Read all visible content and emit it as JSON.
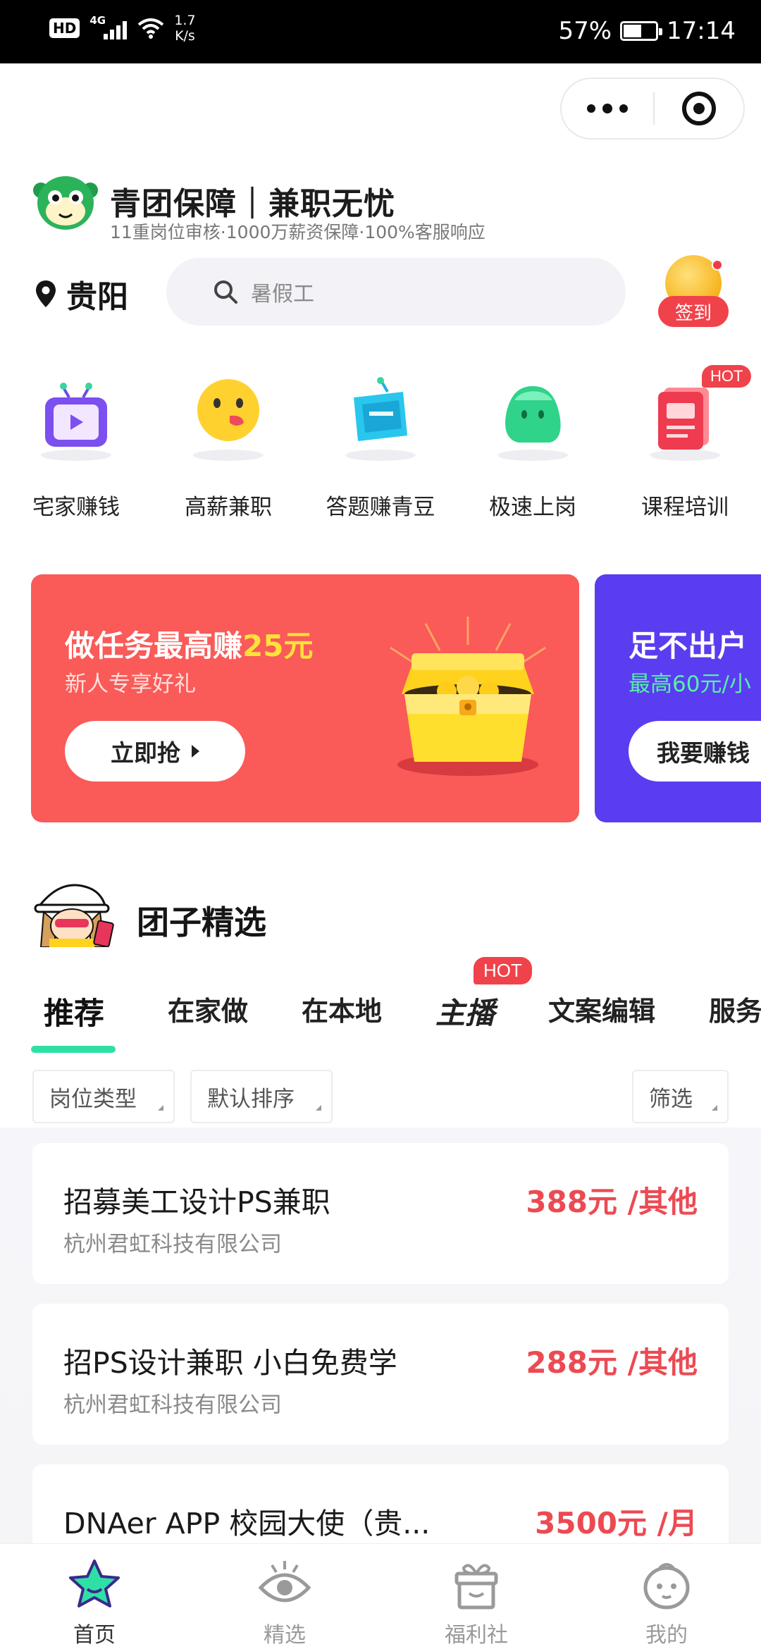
{
  "status_bar": {
    "hd": "HD",
    "network": "4G",
    "speed_value": "1.7",
    "speed_unit": "K/s",
    "battery": "57%",
    "battery_level": 0.57,
    "time": "17:14"
  },
  "brand": {
    "title": "青团保障｜兼职无忧",
    "subtitle": "11重岗位审核·1000万薪资保障·100%客服响应"
  },
  "location": {
    "city": "贵阳"
  },
  "search": {
    "placeholder": "暑假工"
  },
  "checkin": {
    "label": "签到"
  },
  "categories": [
    {
      "label": "宅家赚钱",
      "icon": "tv-icon"
    },
    {
      "label": "高薪兼职",
      "icon": "smiley-icon"
    },
    {
      "label": "答题赚青豆",
      "icon": "chat-tv-icon"
    },
    {
      "label": "极速上岗",
      "icon": "green-blob-icon"
    },
    {
      "label": "课程培训",
      "icon": "book-icon",
      "badge": "HOT"
    }
  ],
  "banners": [
    {
      "title_prefix": "做任务最高赚",
      "title_highlight": "25元",
      "subtitle": "新人专享好礼",
      "button": "立即抢",
      "color": "#fa5a58"
    },
    {
      "title": "足不出户",
      "subtitle": "最高60元/小",
      "button": "我要赚钱",
      "color": "#5a3df0"
    }
  ],
  "section": {
    "title": "团子精选"
  },
  "tabs": [
    {
      "label": "推荐",
      "active": true
    },
    {
      "label": "在家做"
    },
    {
      "label": "在本地"
    },
    {
      "label": "主播",
      "badge": "HOT"
    },
    {
      "label": "文案编辑"
    },
    {
      "label": "服务"
    }
  ],
  "filters": {
    "type": "岗位类型",
    "sort": "默认排序",
    "filter": "筛选"
  },
  "jobs": [
    {
      "title": "招募美工设计PS兼职",
      "company": "杭州君虹科技有限公司",
      "pay": "388元 /其他"
    },
    {
      "title": "招PS设计兼职 小白免费学",
      "company": "杭州君虹科技有限公司",
      "pay": "288元 /其他"
    },
    {
      "title": "DNAer APP 校园大使（贵...",
      "company": "",
      "pay": "3500元 /月"
    }
  ],
  "bottom_nav": [
    {
      "label": "首页",
      "icon": "star-home-icon",
      "active": true
    },
    {
      "label": "精选",
      "icon": "eye-icon"
    },
    {
      "label": "福利社",
      "icon": "gift-box-icon"
    },
    {
      "label": "我的",
      "icon": "face-icon"
    }
  ],
  "colors": {
    "accent_red": "#f0424a",
    "accent_green": "#2fe0a6",
    "price_red": "#ec4a52",
    "banner_purple": "#5a3df0"
  }
}
